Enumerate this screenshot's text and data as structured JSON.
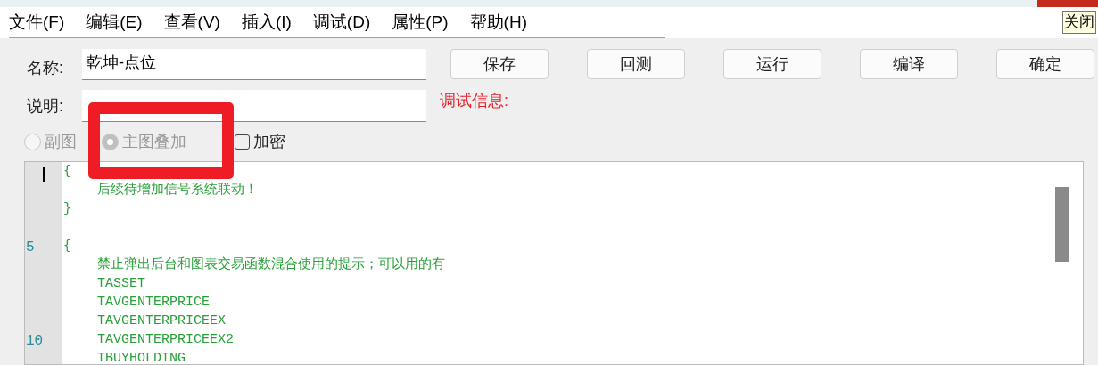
{
  "menu": [
    {
      "label": "文件(F)"
    },
    {
      "label": "编辑(E)"
    },
    {
      "label": "查看(V)"
    },
    {
      "label": "插入(I)"
    },
    {
      "label": "调试(D)"
    },
    {
      "label": "属性(P)"
    },
    {
      "label": "帮助(H)"
    }
  ],
  "close_tooltip": "关闭",
  "form": {
    "name_label": "名称:",
    "name_value": "乾坤-点位",
    "desc_label": "说明:",
    "debug_label": "调试信息:"
  },
  "buttons": [
    "保存",
    "回测",
    "运行",
    "编译",
    "确定"
  ],
  "options": [
    {
      "kind": "radio",
      "label": "副图",
      "selected": false,
      "disabled": true
    },
    {
      "kind": "radio",
      "label": "主图叠加",
      "selected": true,
      "disabled": true
    },
    {
      "kind": "checkbox",
      "label": "加密",
      "checked": false,
      "disabled": false
    }
  ],
  "editor": {
    "blocks": [
      {
        "open": "{",
        "body": [
          {
            "text": "后续待增加信号系统联动！"
          }
        ],
        "close": "}"
      },
      {
        "open": "{",
        "open_number": "5",
        "body": [
          {
            "text": "禁止弹出后台和图表交易函数混合使用的提示；可以用的有"
          },
          {
            "text": "TASSET"
          },
          {
            "text": "TAVGENTERPRICE"
          },
          {
            "text": "TAVGENTERPRICEEX"
          },
          {
            "number": "10",
            "text": "TAVGENTERPRICEEX2"
          },
          {
            "text": "TBUYHOLDING"
          }
        ]
      }
    ]
  }
}
